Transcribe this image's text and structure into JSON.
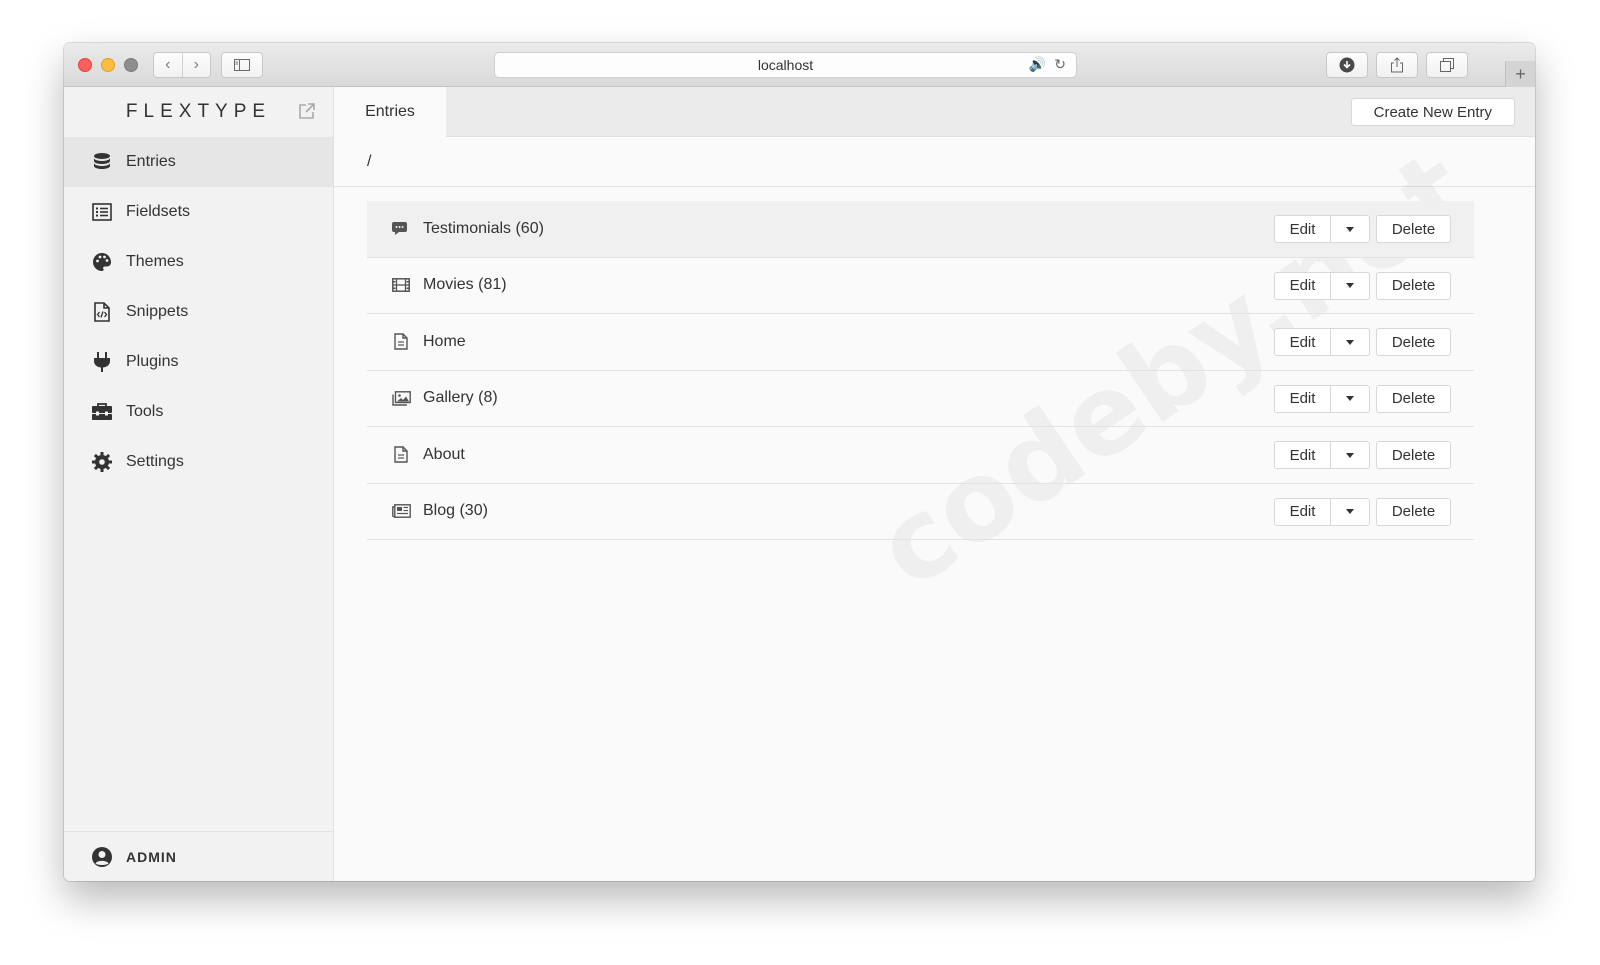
{
  "browser": {
    "url": "localhost"
  },
  "sidebar": {
    "brand": "FLEXTYPE",
    "items": [
      {
        "label": "Entries",
        "icon": "database-icon",
        "active": true
      },
      {
        "label": "Fieldsets",
        "icon": "list-icon"
      },
      {
        "label": "Themes",
        "icon": "palette-icon"
      },
      {
        "label": "Snippets",
        "icon": "code-file-icon"
      },
      {
        "label": "Plugins",
        "icon": "plug-icon"
      },
      {
        "label": "Tools",
        "icon": "toolbox-icon"
      },
      {
        "label": "Settings",
        "icon": "gear-icon"
      }
    ],
    "user": "ADMIN"
  },
  "header": {
    "tab": "Entries",
    "create_button": "Create New Entry"
  },
  "breadcrumb": "/",
  "entries": [
    {
      "label": "Testimonials (60)",
      "icon": "comments-icon"
    },
    {
      "label": "Movies (81)",
      "icon": "film-icon"
    },
    {
      "label": "Home",
      "icon": "file-icon"
    },
    {
      "label": "Gallery (8)",
      "icon": "images-icon"
    },
    {
      "label": "About",
      "icon": "file-icon"
    },
    {
      "label": "Blog (30)",
      "icon": "newspaper-icon"
    }
  ],
  "actions": {
    "edit": "Edit",
    "delete": "Delete"
  },
  "watermark": "codeby.net",
  "colors": {
    "close": "#fc605c",
    "minimize": "#fdbc40",
    "sidebar_bg": "#f2f2f2",
    "active_item_bg": "#e6e6e6"
  }
}
